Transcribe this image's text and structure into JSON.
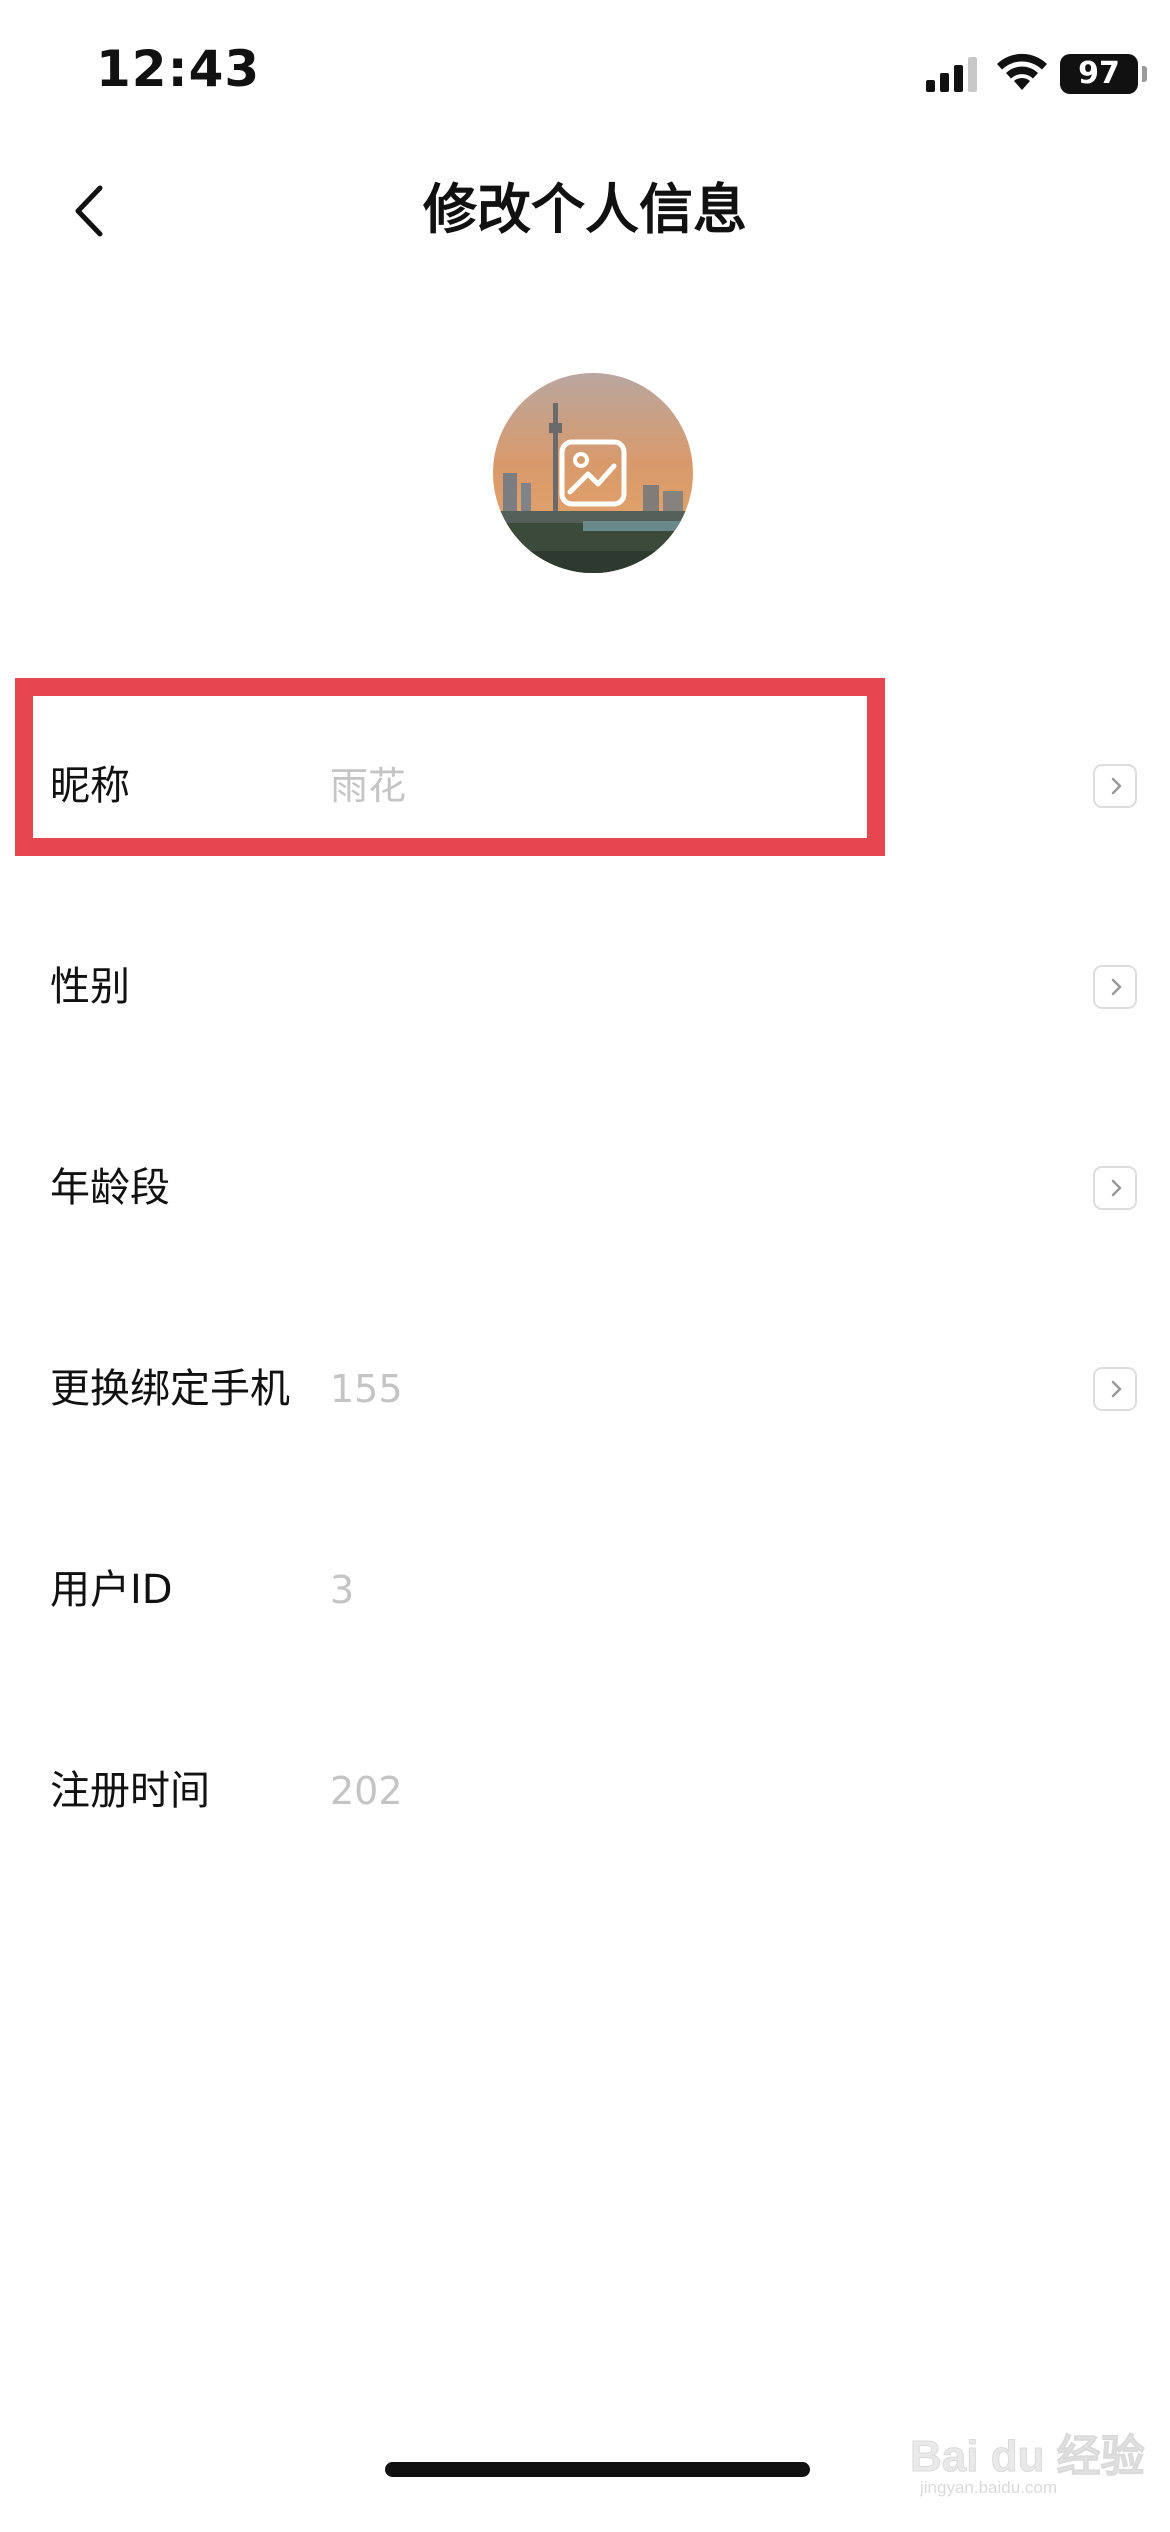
{
  "status_bar": {
    "time": "12:43",
    "battery": "97",
    "icons": [
      "cellular-signal-icon",
      "wifi-icon",
      "battery-icon"
    ]
  },
  "nav": {
    "back_icon": "chevron-left-icon",
    "title": "修改个人信息"
  },
  "avatar": {
    "edit_icon": "image-edit-icon"
  },
  "rows": [
    {
      "label": "昵称",
      "value": "雨花",
      "has_chevron": true
    },
    {
      "label": "性别",
      "value": "",
      "has_chevron": true
    },
    {
      "label": "年龄段",
      "value": "",
      "has_chevron": true
    },
    {
      "label": "更换绑定手机",
      "value": "155",
      "has_chevron": true
    },
    {
      "label": "用户ID",
      "value": "3",
      "has_chevron": false
    },
    {
      "label": "注册时间",
      "value": "202",
      "has_chevron": false
    }
  ],
  "highlight_color": "#e8464f",
  "watermark": {
    "brand": "Bai du 经验",
    "sub": "jingyan.baidu.com"
  }
}
